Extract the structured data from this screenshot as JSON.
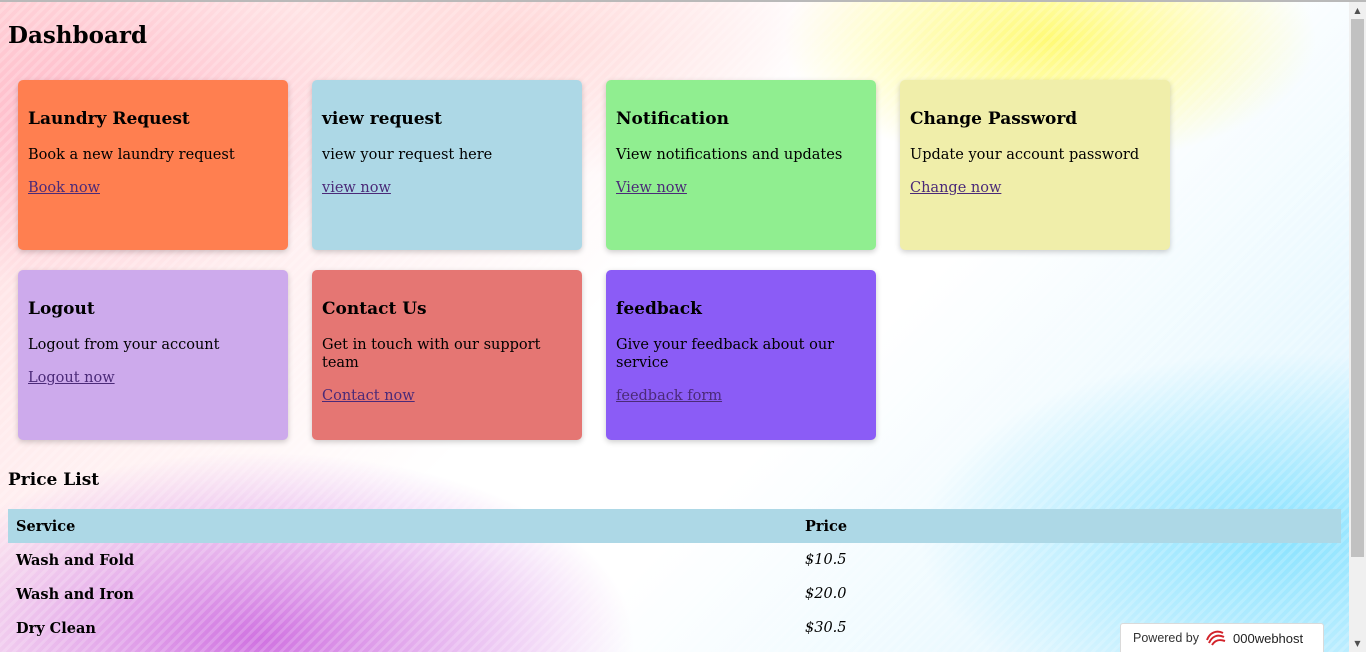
{
  "page": {
    "title": "Dashboard"
  },
  "cards": [
    {
      "title": "Laundry Request",
      "description": "Book a new laundry request",
      "link": "Book now",
      "color": "#ff7f50"
    },
    {
      "title": "view request",
      "description": "view your request here",
      "link": "view now",
      "color": "#add8e6"
    },
    {
      "title": "Notification",
      "description": "View notifications and updates",
      "link": "View now",
      "color": "#90ee90"
    },
    {
      "title": "Change Password",
      "description": "Update your account password",
      "link": "Change now",
      "color": "#f0eeaa"
    },
    {
      "title": "Logout",
      "description": "Logout from your account",
      "link": "Logout now",
      "color": "#cdaaec"
    },
    {
      "title": "Contact Us",
      "description": "Get in touch with our support team",
      "link": "Contact now",
      "color": "#e57673"
    },
    {
      "title": "feedback",
      "description": "Give your feedback about our service",
      "link": "feedback form",
      "color": "#8b5cf6"
    }
  ],
  "price_list": {
    "heading": "Price List",
    "columns": [
      "Service",
      "Price"
    ],
    "rows": [
      {
        "service": "Wash and Fold",
        "price": "$10.5"
      },
      {
        "service": "Wash and Iron",
        "price": "$20.0"
      },
      {
        "service": "Dry Clean",
        "price": "$30.5"
      }
    ]
  },
  "footer_badge": {
    "powered_by": "Powered by",
    "brand": "000webhost"
  },
  "scrollbar": {
    "up_icon": "scroll-up-arrow-icon",
    "down_icon": "scroll-down-arrow-icon"
  },
  "colors": {
    "table_header": "#add8e6",
    "link": "#4b2a78"
  }
}
